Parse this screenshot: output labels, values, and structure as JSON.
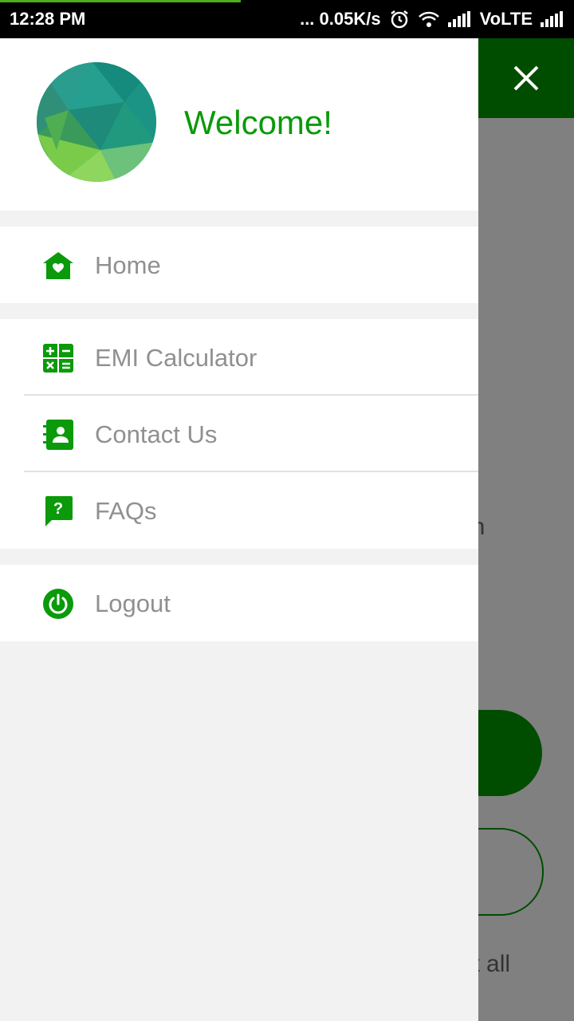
{
  "status_bar": {
    "time": "12:28 PM",
    "network_speed": "... 0.05K/s",
    "carrier": "VoLTE"
  },
  "background": {
    "partial_text_1": "ash",
    "partial_text_2": "ept all"
  },
  "drawer": {
    "welcome": "Welcome!",
    "sections": [
      {
        "items": [
          {
            "label": "Home",
            "icon": "home-icon"
          }
        ]
      },
      {
        "items": [
          {
            "label": "EMI Calculator",
            "icon": "calculator-icon"
          },
          {
            "label": "Contact Us",
            "icon": "contact-book-icon"
          },
          {
            "label": "FAQs",
            "icon": "faq-icon"
          }
        ]
      },
      {
        "items": [
          {
            "label": "Logout",
            "icon": "power-icon"
          }
        ]
      }
    ]
  },
  "colors": {
    "brand_green": "#0a9a0a",
    "dark_green": "#004d00",
    "menu_text": "#909090"
  }
}
